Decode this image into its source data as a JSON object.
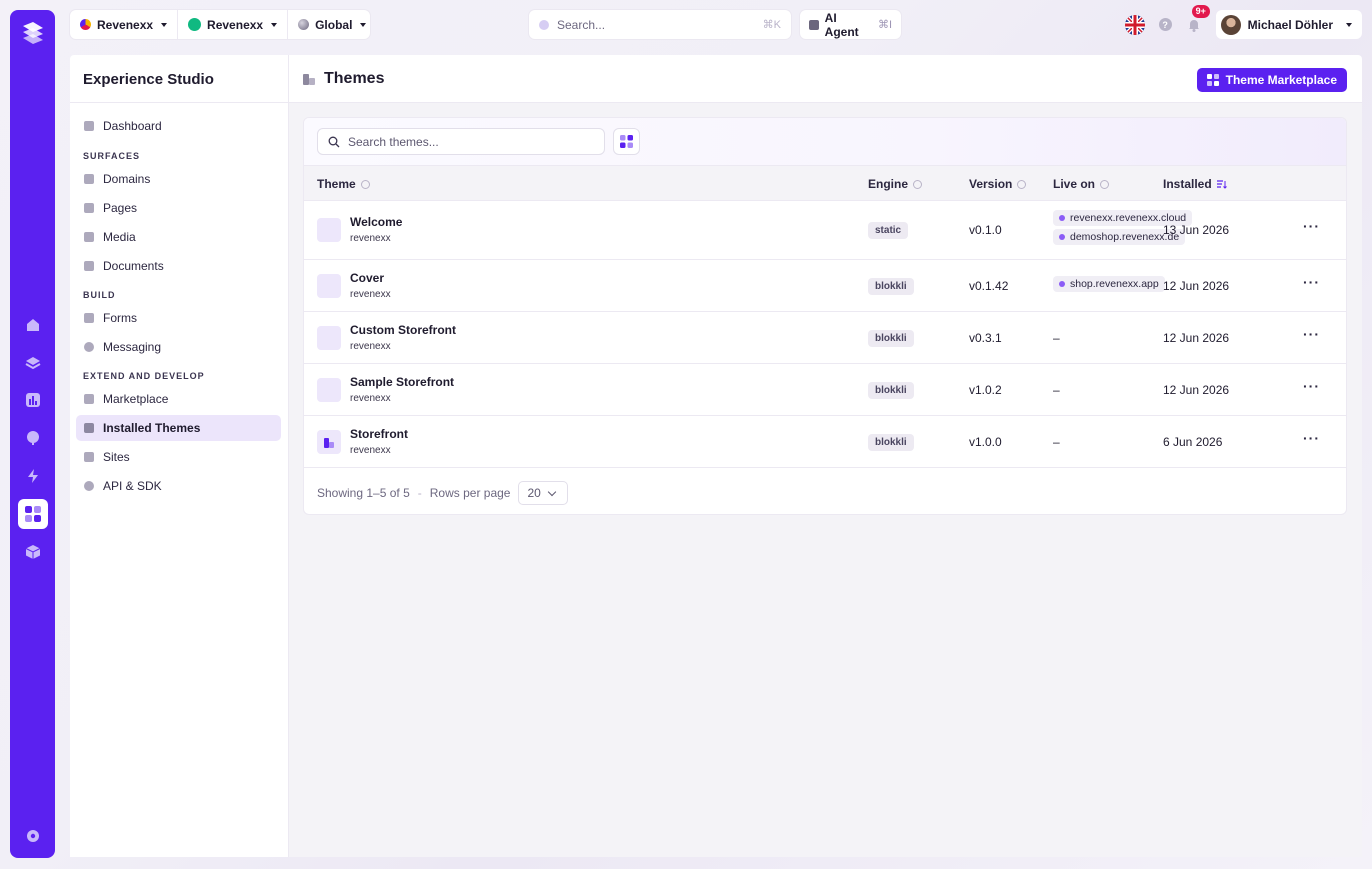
{
  "topbar": {
    "org": "Revenexx",
    "workspace": "Revenexx",
    "region": "Global",
    "search_placeholder": "Search...",
    "search_shortcut": "⌘K",
    "agent_label": "AI Agent",
    "agent_shortcut": "⌘I",
    "notifications_badge": "9+",
    "user_name": "Michael Döhler",
    "help": "?"
  },
  "sidebar": {
    "title": "Experience Studio",
    "dashboard": "Dashboard",
    "sections": {
      "surfaces": "SURFACES",
      "build": "BUILD",
      "extend": "EXTEND AND DEVELOP"
    },
    "items": {
      "domains": "Domains",
      "pages": "Pages",
      "media": "Media",
      "documents": "Documents",
      "forms": "Forms",
      "messaging": "Messaging",
      "marketplace": "Marketplace",
      "installed_themes": "Installed Themes",
      "sites": "Sites",
      "api_sdk": "API & SDK"
    }
  },
  "header": {
    "title": "Themes",
    "marketplace_button": "Theme Marketplace"
  },
  "table": {
    "search_placeholder": "Search themes...",
    "columns": {
      "theme": "Theme",
      "engine": "Engine",
      "version": "Version",
      "live_on": "Live on",
      "installed": "Installed"
    },
    "rows": [
      {
        "name": "Welcome",
        "vendor": "revenexx",
        "engine": "static",
        "version": "v0.1.0",
        "live": [
          "revenexx.revenexx.cloud",
          "demoshop.revenexx.de"
        ],
        "installed": "13 Jun 2026"
      },
      {
        "name": "Cover",
        "vendor": "revenexx",
        "engine": "blokkli",
        "version": "v0.1.42",
        "live": [
          "shop.revenexx.app"
        ],
        "installed": "12 Jun 2026"
      },
      {
        "name": "Custom Storefront",
        "vendor": "revenexx",
        "engine": "blokkli",
        "version": "v0.3.1",
        "live_text": "–",
        "installed": "12 Jun 2026"
      },
      {
        "name": "Sample Storefront",
        "vendor": "revenexx",
        "engine": "blokkli",
        "version": "v1.0.2",
        "live_text": "–",
        "installed": "12 Jun 2026"
      },
      {
        "name": "Storefront",
        "vendor": "revenexx",
        "engine": "blokkli",
        "version": "v1.0.0",
        "live_text": "–",
        "installed": "6 Jun 2026"
      }
    ],
    "row_menu": "···",
    "footer": {
      "showing": "Showing 1–5 of 5",
      "separator": "-",
      "rows_per_page_label": "Rows per page",
      "rows_per_page_value": "20"
    }
  },
  "colors": {
    "brand": "#5b21f0",
    "active_nav_bg": "#ece5fb",
    "badge": "#e2194d"
  }
}
